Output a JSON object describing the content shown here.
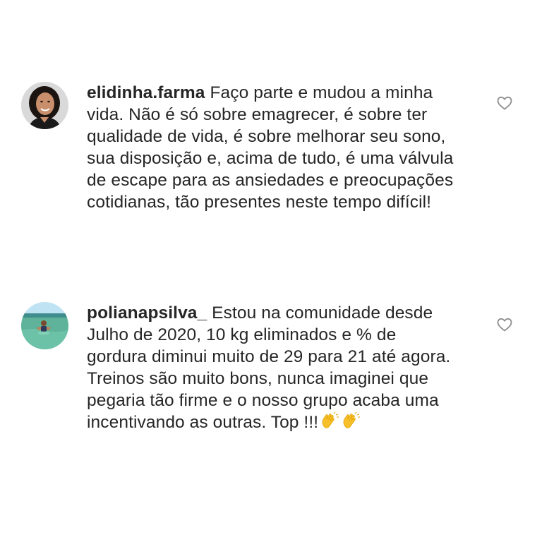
{
  "comments": [
    {
      "username": "elidinha.farma",
      "text": "Faço parte e mudou a minha\nvida. Não é só sobre emagrecer, é sobre ter\nqualidade de vida, é sobre melhorar seu sono,\nsua disposição e, acima de tudo, é uma válvula\nde escape para as ansiedades e preocupações\ncotidianas, tão presentes neste tempo difícil!",
      "avatar_icon": "profile-photo-woman",
      "like_icon": "heart-outline-icon"
    },
    {
      "username": "polianapsilva_",
      "text": "Estou na comunidade desde\nJulho de  2020, 10 kg eliminados e % de\ngordura diminui muito de 29 para 21 até agora.\nTreinos são muito bons, nunca imaginei que\npegaria tão firme e o nosso grupo acaba uma\nincentivando as outras. Top !!!",
      "trailing_emoji": [
        "clapping-hands",
        "clapping-hands"
      ],
      "avatar_icon": "profile-photo-woman-in-water",
      "like_icon": "heart-outline-icon"
    }
  ],
  "colors": {
    "text": "#262626",
    "heart_outline": "#8e8e8e",
    "background": "#ffffff"
  }
}
